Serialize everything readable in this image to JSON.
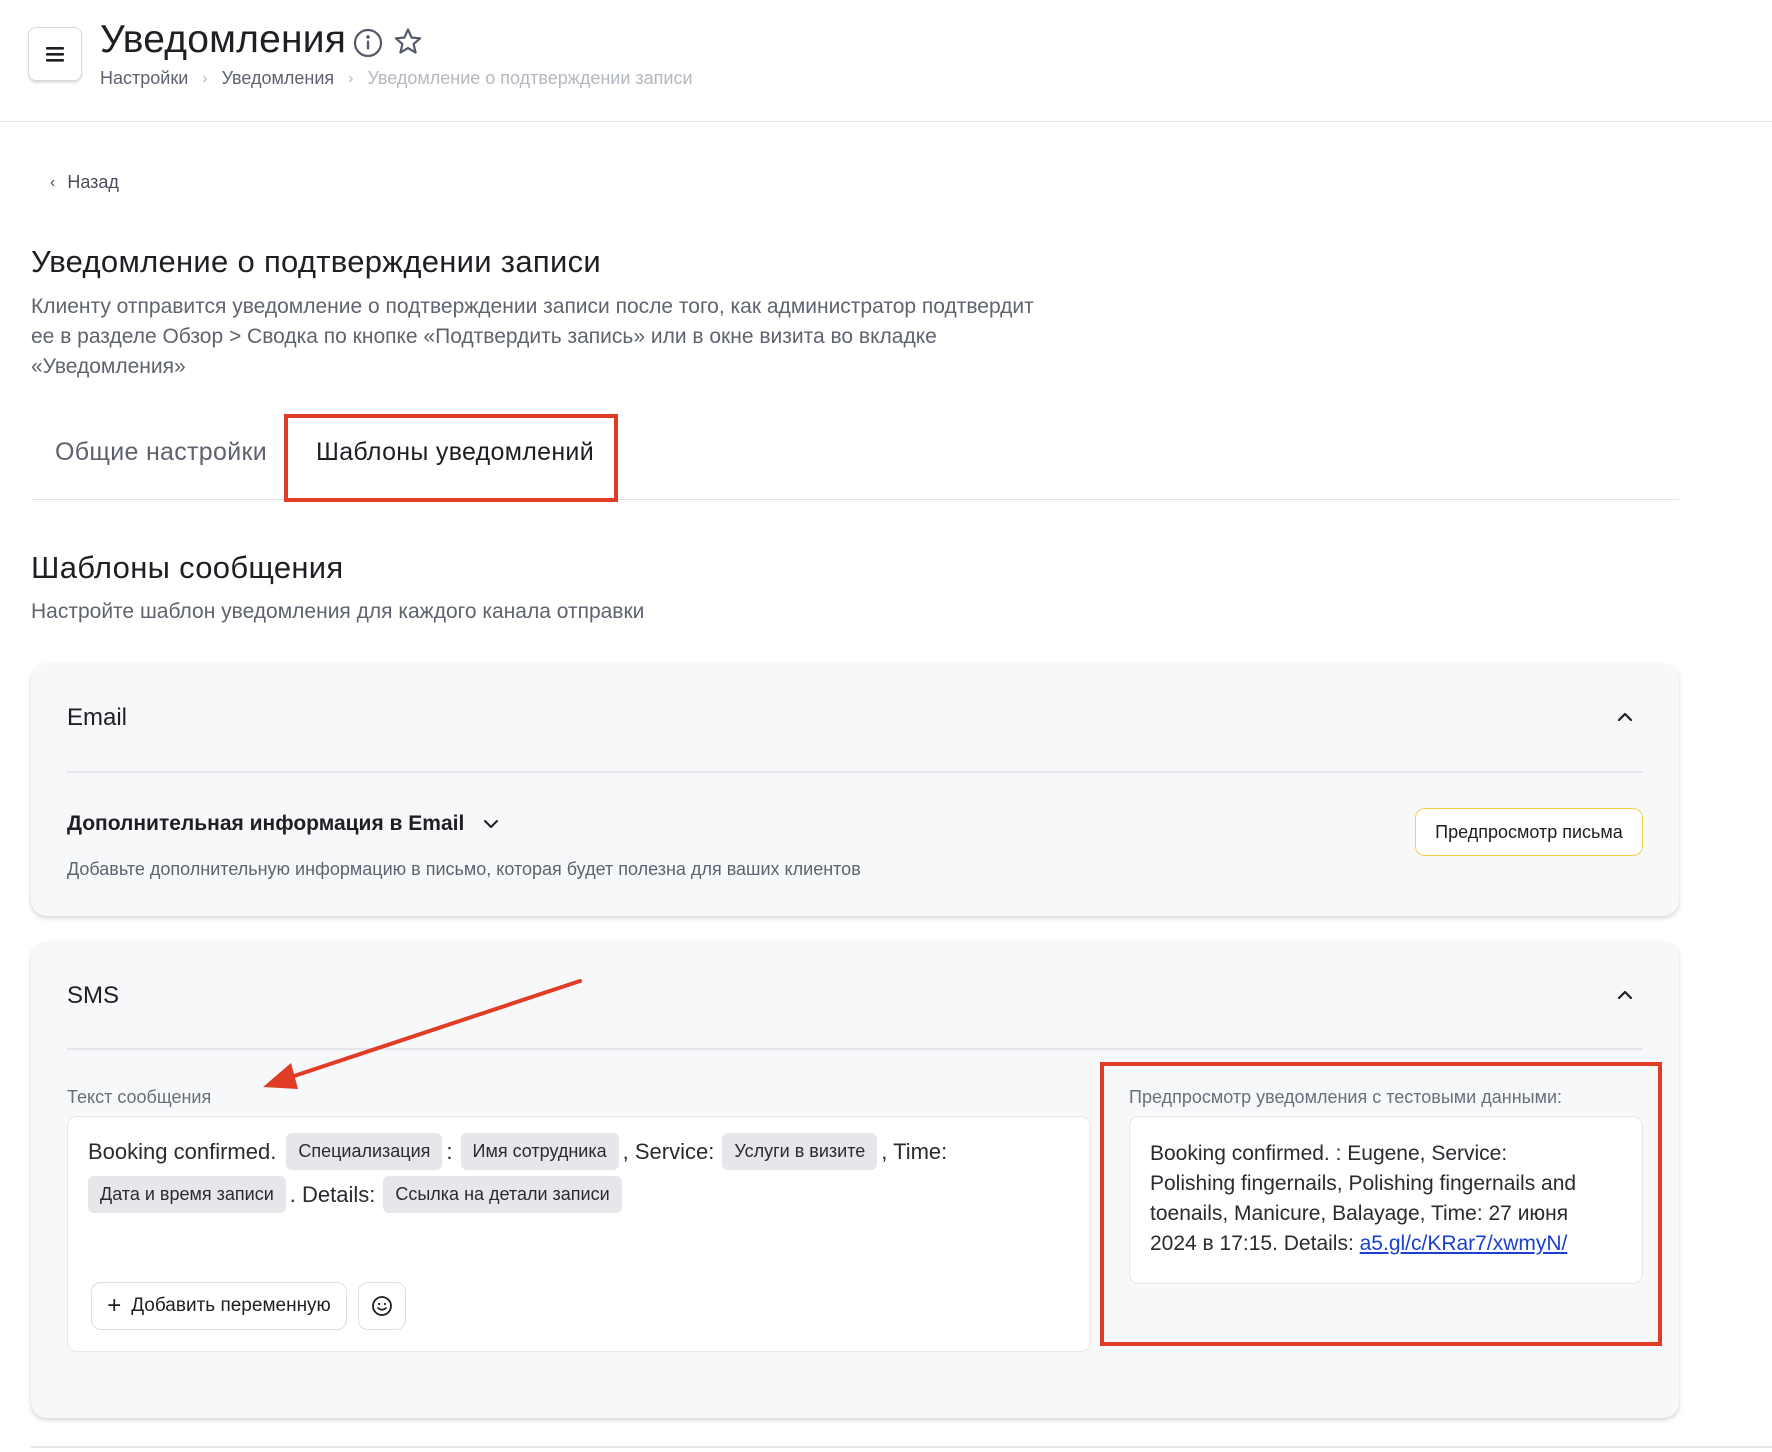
{
  "header": {
    "title": "Уведомления",
    "breadcrumb": [
      "Настройки",
      "Уведомления",
      "Уведомление о подтверждении записи"
    ]
  },
  "back": {
    "label": "Назад"
  },
  "section": {
    "title": "Уведомление о подтверждении записи",
    "description_lines": [
      "Клиенту отправится уведомление о подтверждении записи после того, как администратор подтвердит",
      "ее в разделе Обзор > Сводка по кнопке «Подтвердить запись» или в окне визита во вкладке",
      "«Уведомления»"
    ]
  },
  "tabs": [
    {
      "label": "Общие настройки",
      "active": false
    },
    {
      "label": "Шаблоны уведомлений",
      "active": true
    }
  ],
  "templates": {
    "title": "Шаблоны сообщения",
    "description": "Настройте шаблон уведомления для каждого канала отправки"
  },
  "email": {
    "title": "Email",
    "extra_title": "Дополнительная информация в Email",
    "extra_description": "Добавьте дополнительную информацию в письмо, которая будет полезна для ваших клиентов",
    "preview_button": "Предпросмотр письма"
  },
  "sms": {
    "title": "SMS",
    "message_label": "Текст сообщения",
    "message": {
      "t1": "Booking confirmed.",
      "chip1": "Специализация",
      "t2": ":",
      "chip2": "Имя сотрудника",
      "t3": ", Service:",
      "chip3": "Услуги в визите",
      "t4": ", Time:",
      "chip4": "Дата и время записи",
      "t5": ". Details:",
      "chip5": "Ссылка на детали записи"
    },
    "add_variable_button": "Добавить переменную",
    "preview_label": "Предпросмотр уведомления с тестовыми данными:",
    "preview_text_lines": [
      "Booking confirmed. : Eugene, Service:",
      "Polishing fingernails, Polishing fingernails and",
      "toenails, Manicure, Balayage, Time: 27 июня"
    ],
    "preview_last_line_prefix": "2024 в 17:15. Details: ",
    "preview_link": "a5.gl/c/KRar7/xwmyN/"
  },
  "colors": {
    "annotation_red": "#e03c26",
    "preview_button_border": "#f2cf54",
    "link_blue": "#1b3fd0"
  }
}
